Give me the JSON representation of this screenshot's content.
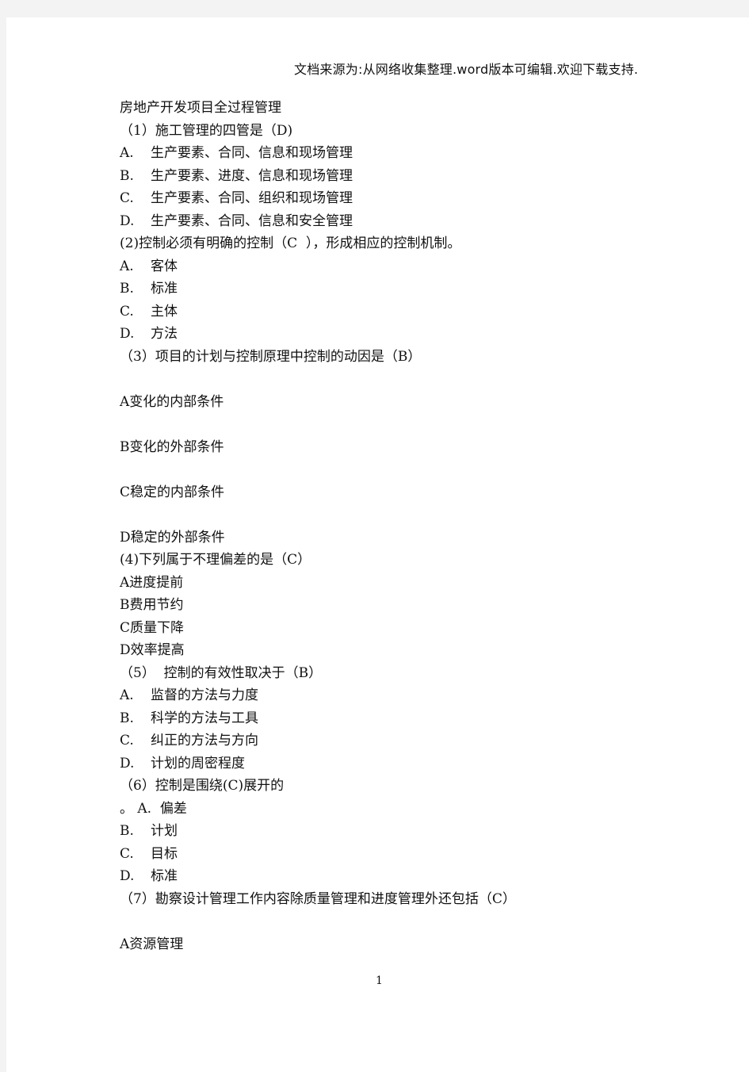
{
  "header": {
    "text": "文档来源为:从网络收集整理.word版本可编辑.欢迎下载支持."
  },
  "document": {
    "title": "房地产开发项目全过程管理",
    "lines": [
      {
        "type": "question",
        "text": "（1）施工管理的四管是（D)"
      },
      {
        "type": "option",
        "label": "A.",
        "text": "生产要素、合同、信息和现场管理"
      },
      {
        "type": "option",
        "label": "B.",
        "text": "生产要素、进度、信息和现场管理"
      },
      {
        "type": "option",
        "label": "C.",
        "text": "生产要素、合同、组织和现场管理"
      },
      {
        "type": "option",
        "label": "D.",
        "text": "生产要素、合同、信息和安全管理"
      },
      {
        "type": "question",
        "text": "(2)控制必须有明确的控制（C  ），形成相应的控制机制。"
      },
      {
        "type": "option",
        "label": "A.",
        "text": "客体"
      },
      {
        "type": "option",
        "label": "B.",
        "text": "标准"
      },
      {
        "type": "option",
        "label": "C.",
        "text": "主体"
      },
      {
        "type": "option",
        "label": "D.",
        "text": "方法"
      },
      {
        "type": "question",
        "text": "（3）项目的计划与控制原理中控制的动因是（B）"
      },
      {
        "type": "blank"
      },
      {
        "type": "plain",
        "text": "A变化的内部条件"
      },
      {
        "type": "blank"
      },
      {
        "type": "plain",
        "text": "B变化的外部条件"
      },
      {
        "type": "blank"
      },
      {
        "type": "plain",
        "text": "C稳定的内部条件"
      },
      {
        "type": "blank"
      },
      {
        "type": "plain",
        "text": "D稳定的外部条件"
      },
      {
        "type": "question",
        "text": "(4)下列属于不理偏差的是（C）"
      },
      {
        "type": "plain",
        "text": "A进度提前"
      },
      {
        "type": "plain",
        "text": "B费用节约"
      },
      {
        "type": "plain",
        "text": "C质量下降"
      },
      {
        "type": "plain",
        "text": "D效率提高"
      },
      {
        "type": "question",
        "text": "（5）  控制的有效性取决于（B）"
      },
      {
        "type": "option",
        "label": "A.",
        "text": "监督的方法与力度"
      },
      {
        "type": "option",
        "label": "B.",
        "text": "科学的方法与工具"
      },
      {
        "type": "option",
        "label": "C.",
        "text": "纠正的方法与方向"
      },
      {
        "type": "option",
        "label": "D.",
        "text": "计划的周密程度"
      },
      {
        "type": "question",
        "text": "（6）控制是围绕(C)展开的"
      },
      {
        "type": "plain",
        "text": "。 A.  偏差"
      },
      {
        "type": "option",
        "label": "B.",
        "text": "计划"
      },
      {
        "type": "option",
        "label": "C.",
        "text": "目标"
      },
      {
        "type": "option",
        "label": "D.",
        "text": "标准"
      },
      {
        "type": "question",
        "text": "（7）勘察设计管理工作内容除质量管理和进度管理外还包括（C）"
      },
      {
        "type": "blank"
      },
      {
        "type": "plain",
        "text": "A资源管理"
      }
    ]
  },
  "footer": {
    "page_number": "1"
  }
}
